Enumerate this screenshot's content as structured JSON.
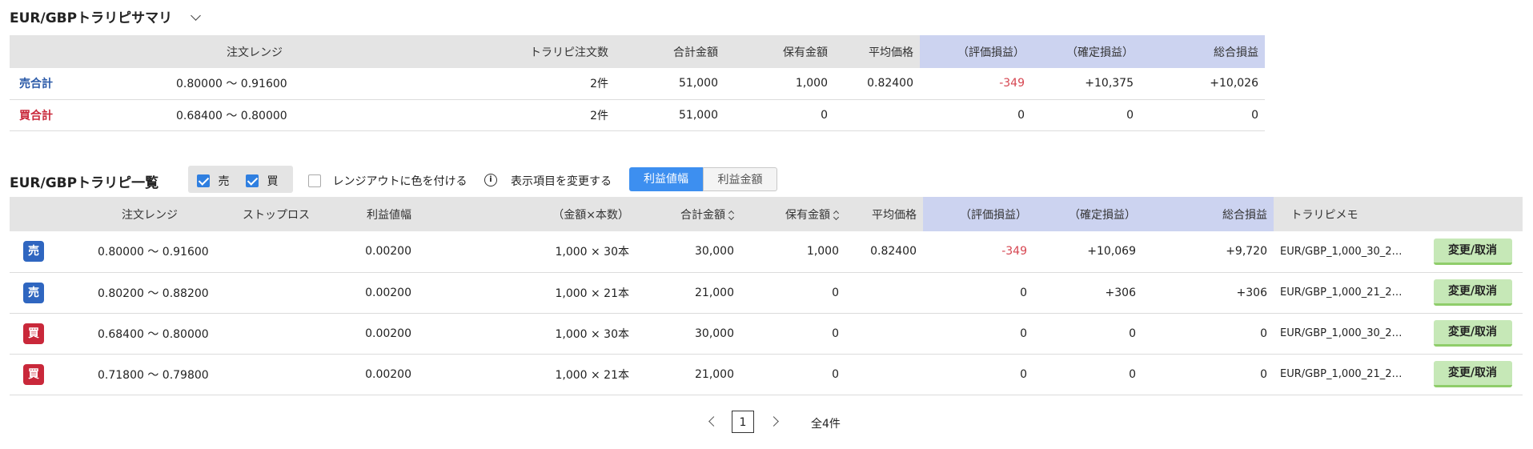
{
  "summary": {
    "title": "EUR/GBPトラリピサマリ",
    "headers": {
      "range": "注文レンジ",
      "order_count": "トラリピ注文数",
      "total_amount": "合計金額",
      "held_amount": "保有金額",
      "avg_price": "平均価格",
      "unrealized": "（評価損益）",
      "realized": "（確定損益）",
      "total_pl": "総合損益"
    },
    "rows": [
      {
        "label": "売合計",
        "range": "0.80000 〜 0.91600",
        "order_count": "2件",
        "total_amount": "51,000",
        "held_amount": "1,000",
        "avg_price": "0.82400",
        "unrealized": "-349",
        "realized": "+10,375",
        "total_pl": "+10,026"
      },
      {
        "label": "買合計",
        "range": "0.68400 〜 0.80000",
        "order_count": "2件",
        "total_amount": "51,000",
        "held_amount": "0",
        "avg_price": "",
        "unrealized": "0",
        "realized": "0",
        "total_pl": "0"
      }
    ]
  },
  "list": {
    "title": "EUR/GBPトラリピ一覧",
    "filter_sell": "売",
    "filter_buy": "買",
    "range_out_color": "レンジアウトに色を付ける",
    "change_display": "表示項目を変更する",
    "toggle_profit_width": "利益値幅",
    "toggle_profit_amount": "利益金額",
    "headers": {
      "range": "注文レンジ",
      "stop_loss": "ストップロス",
      "profit_width": "利益値幅",
      "amount_qty": "（金額×本数）",
      "total_amount": "合計金額",
      "held_amount": "保有金額",
      "avg_price": "平均価格",
      "unrealized": "（評価損益）",
      "realized": "（確定損益）",
      "total_pl": "総合損益",
      "memo": "トラリピメモ"
    },
    "rows": [
      {
        "side": "売",
        "range": "0.80000 〜 0.91600",
        "stop_loss": "",
        "profit_width": "0.00200",
        "amount_qty": "1,000 × 30本",
        "total_amount": "30,000",
        "held_amount": "1,000",
        "avg_price": "0.82400",
        "unrealized": "-349",
        "realized": "+10,069",
        "total_pl": "+9,720",
        "memo": "EUR/GBP_1,000_30_2…",
        "action": "変更/取消"
      },
      {
        "side": "売",
        "range": "0.80200 〜 0.88200",
        "stop_loss": "",
        "profit_width": "0.00200",
        "amount_qty": "1,000 × 21本",
        "total_amount": "21,000",
        "held_amount": "0",
        "avg_price": "",
        "unrealized": "0",
        "realized": "+306",
        "total_pl": "+306",
        "memo": "EUR/GBP_1,000_21_2…",
        "action": "変更/取消"
      },
      {
        "side": "買",
        "range": "0.68400 〜 0.80000",
        "stop_loss": "",
        "profit_width": "0.00200",
        "amount_qty": "1,000 × 30本",
        "total_amount": "30,000",
        "held_amount": "0",
        "avg_price": "",
        "unrealized": "0",
        "realized": "0",
        "total_pl": "0",
        "memo": "EUR/GBP_1,000_30_2…",
        "action": "変更/取消"
      },
      {
        "side": "買",
        "range": "0.71800 〜 0.79800",
        "stop_loss": "",
        "profit_width": "0.00200",
        "amount_qty": "1,000 × 21本",
        "total_amount": "21,000",
        "held_amount": "0",
        "avg_price": "",
        "unrealized": "0",
        "realized": "0",
        "total_pl": "0",
        "memo": "EUR/GBP_1,000_21_2…",
        "action": "変更/取消"
      }
    ]
  },
  "pagination": {
    "current_page": "1",
    "total": "全4件"
  },
  "colors": {
    "sell": "#2f66c0",
    "buy": "#c9283a",
    "negative": "#d64550",
    "accent": "#3d8ff0",
    "header_blue": "#ccd3f0"
  }
}
